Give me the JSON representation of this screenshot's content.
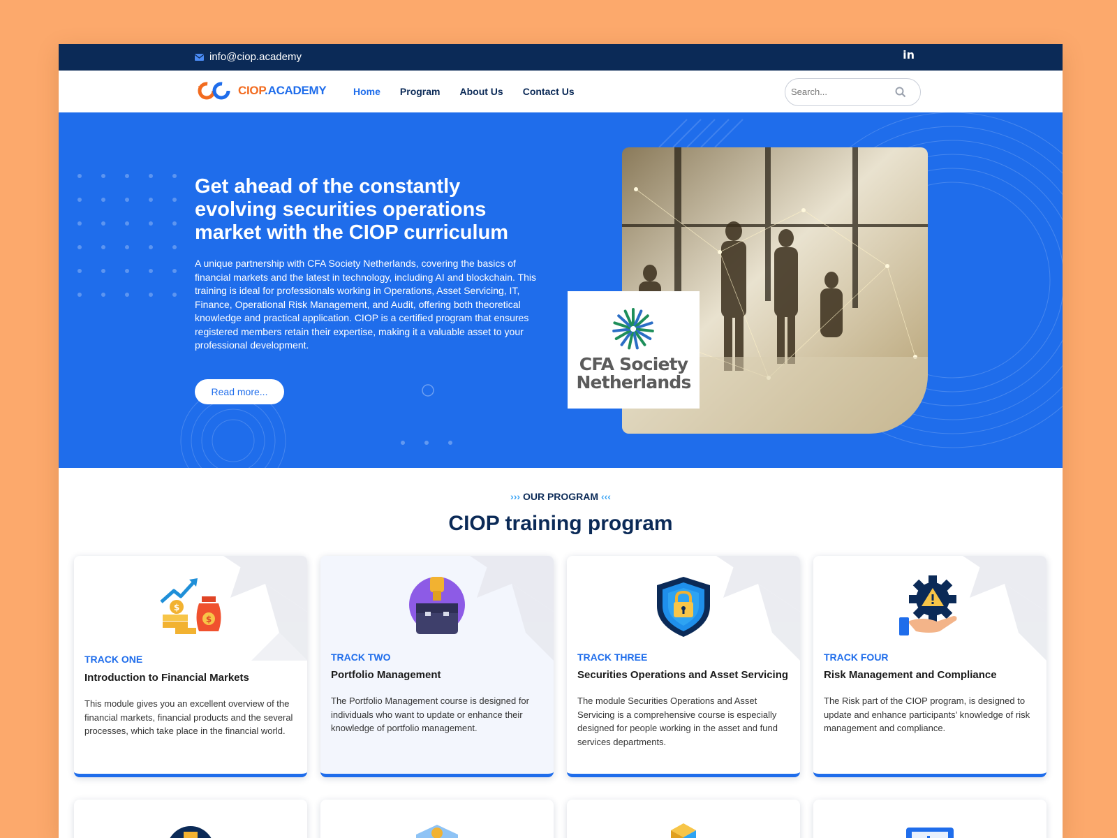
{
  "topbar": {
    "email": "info@ciop.academy",
    "linkedin": "in"
  },
  "nav": {
    "logo_part1": "CIOP",
    "logo_part2": ".ACADEMY",
    "menu": [
      "Home",
      "Program",
      "About Us",
      "Contact Us"
    ],
    "search_placeholder": "Search..."
  },
  "hero": {
    "title": "Get ahead of the constantly evolving securities operations market with the CIOP curriculum",
    "text": "A unique partnership with CFA Society Netherlands, covering the basics of financial markets and the latest in technology, including AI and blockchain. This training is ideal for professionals working in Operations, Asset Servicing, IT, Finance, Operational Risk Management, and Audit, offering both theoretical knowledge and practical application. CIOP is a certified program that ensures registered members retain their expertise, making it a valuable asset to your professional development.",
    "button": "Read more...",
    "partner_line1": "CFA Society",
    "partner_line2": "Netherlands"
  },
  "program": {
    "eyebrow_left": "›››",
    "eyebrow": "OUR PROGRAM",
    "eyebrow_right": "‹‹‹",
    "title": "CIOP training program",
    "cards": [
      {
        "track": "TRACK ONE",
        "title": "Introduction to Financial Markets",
        "text": "This module gives you an excellent overview of the financial markets, financial products and the several processes, which take place in the financial world.",
        "icon": "money-growth-icon"
      },
      {
        "track": "TRACK TWO",
        "title": "Portfolio Management",
        "text": "The Portfolio Management course is designed for individuals who want to update or enhance their knowledge of portfolio management.",
        "icon": "briefcase-icon"
      },
      {
        "track": "TRACK THREE",
        "title": "Securities Operations and Asset Servicing",
        "text": "The module Securities Operations and Asset Servicing is a comprehensive course is especially designed for people working in the asset and fund services departments.",
        "icon": "shield-lock-icon"
      },
      {
        "track": "TRACK FOUR",
        "title": "Risk Management and Compliance",
        "text": "The Risk part of the CIOP program, is designed to update and enhance participants’ knowledge of risk management and compliance.",
        "icon": "gear-warning-icon"
      }
    ]
  },
  "colors": {
    "primary": "#1F6DEB",
    "navy": "#0B2A57",
    "orange": "#F26B1F",
    "background": "#FCA96C"
  }
}
